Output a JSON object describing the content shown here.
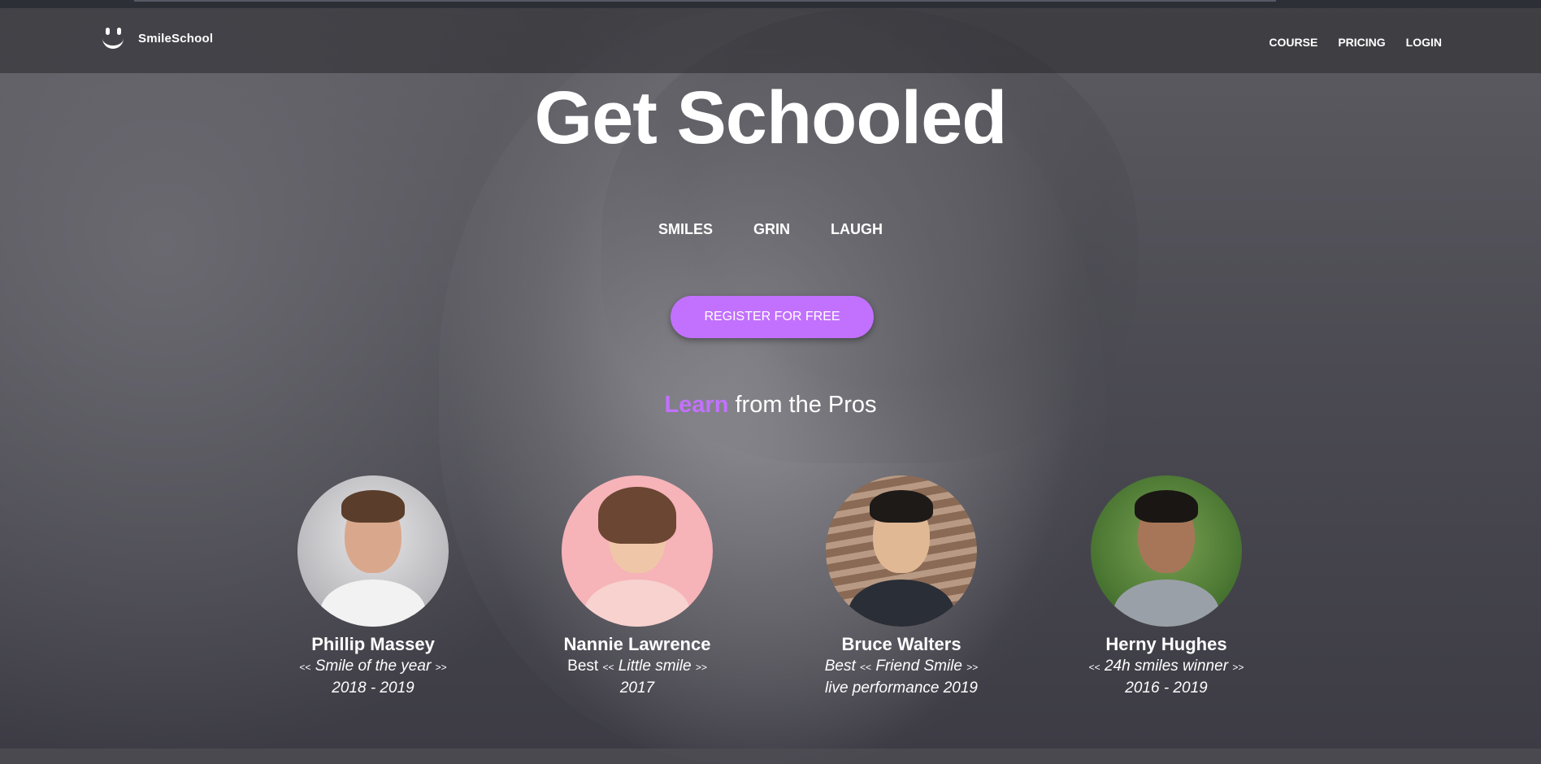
{
  "brand": {
    "name": "SmileSchool"
  },
  "nav": {
    "links": [
      "COURSE",
      "PRICING",
      "LOGIN"
    ]
  },
  "hero": {
    "headline": "Get Schooled",
    "tabs": [
      "SMILES",
      "GRIN",
      "LAUGH"
    ],
    "cta": "REGISTER FOR FREE",
    "learn_accent": "Learn",
    "learn_rest": " from the Pros"
  },
  "pros": [
    {
      "name": "Phillip Massey",
      "prefix": "",
      "title": "Smile of the year",
      "years": "2018 - 2019"
    },
    {
      "name": "Nannie Lawrence",
      "prefix": "Best",
      "title": "Little smile",
      "years": "2017"
    },
    {
      "name": "Bruce Walters",
      "prefix": "Best",
      "title": "Friend Smile",
      "years": "live performance 2019"
    },
    {
      "name": "Herny Hughes",
      "prefix": "",
      "title": "24h smiles winner",
      "years": "2016 - 2019"
    }
  ],
  "quote_open": "<<",
  "quote_close": ">>",
  "colors": {
    "accent": "#c271ff",
    "text": "#ffffff",
    "nav_bg": "#2d2d31"
  },
  "icons": {
    "logo": "smiley-face-icon"
  }
}
